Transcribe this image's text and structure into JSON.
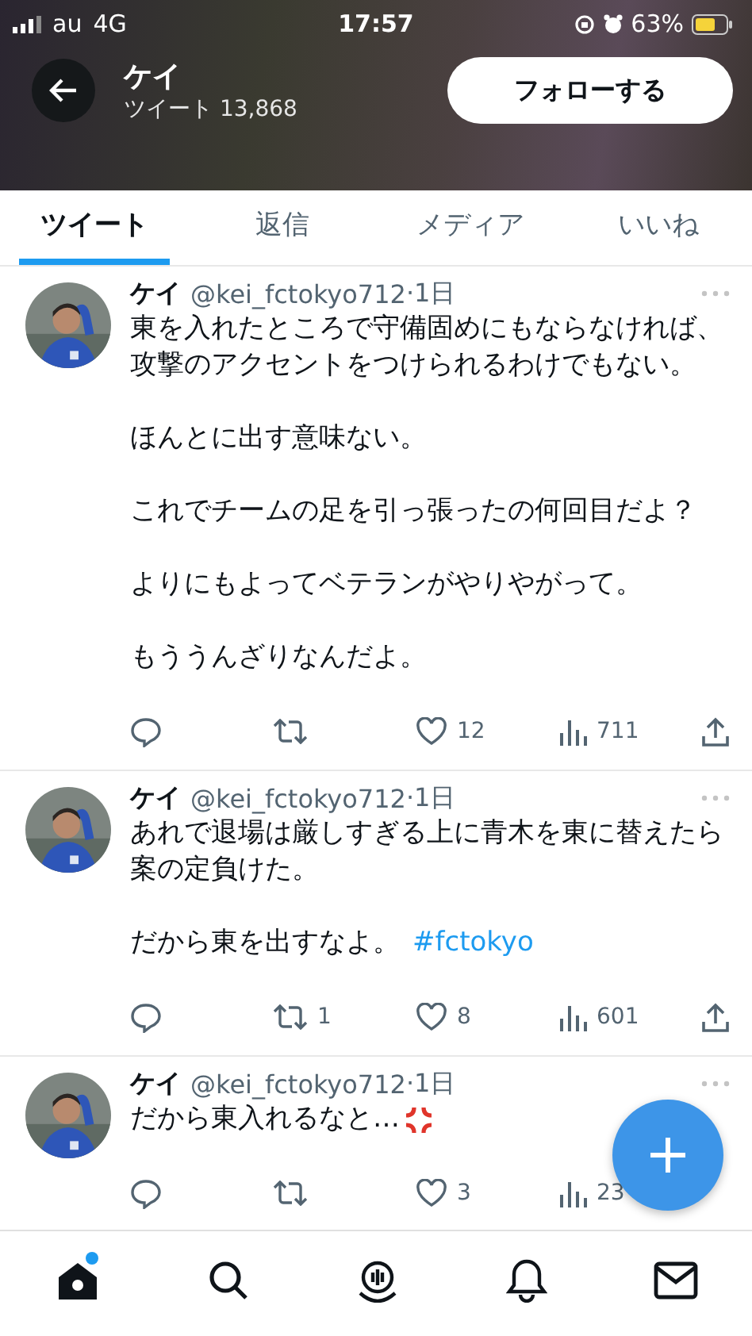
{
  "status_bar": {
    "carrier": "au",
    "network": "4G",
    "time": "17:57",
    "battery": "63%"
  },
  "header": {
    "name": "ケイ",
    "tweet_count": "ツイート 13,868",
    "follow_button": "フォローする"
  },
  "tabs": [
    {
      "label": "ツイート",
      "selected": true
    },
    {
      "label": "返信",
      "selected": false
    },
    {
      "label": "メディア",
      "selected": false
    },
    {
      "label": "いいね",
      "selected": false
    }
  ],
  "tweets": [
    {
      "name": "ケイ",
      "handle": "@kei_fctokyo712",
      "time": "·1日",
      "paragraphs": [
        {
          "text": "東を入れたところで守備固めにもならなければ、攻撃のアクセントをつけられるわけでもない。"
        },
        {
          "text": "ほんとに出す意味ない。"
        },
        {
          "text": "これでチームの足を引っ張ったの何回目だよ？"
        },
        {
          "text": "よりにもよってベテランがやりやがって。"
        },
        {
          "text": "もううんざりなんだよ。"
        }
      ],
      "likes": "12",
      "views": "711",
      "anger_emoji": false
    },
    {
      "name": "ケイ",
      "handle": "@kei_fctokyo712",
      "time": "·1日",
      "paragraphs": [
        {
          "text": "あれで退場は厳しすぎる上に青木を東に替えたら案の定負けた。"
        },
        {
          "text": "だから東を出すなよ。",
          "link": "#fctokyo"
        }
      ],
      "retweets": "1",
      "likes": "8",
      "views": "601",
      "anger_emoji": false
    },
    {
      "name": "ケイ",
      "handle": "@kei_fctokyo712",
      "time": "·1日",
      "paragraphs": [
        {
          "text": "だから東入れるなと…"
        }
      ],
      "likes": "3",
      "views": "23",
      "anger_emoji": true
    }
  ],
  "nav": [
    {
      "kind": "home",
      "selected": true,
      "dot": true
    },
    {
      "kind": "search",
      "selected": false,
      "dot": false
    },
    {
      "kind": "spaces",
      "selected": false,
      "dot": false
    },
    {
      "kind": "notifications",
      "selected": false,
      "dot": false
    },
    {
      "kind": "messages",
      "selected": false,
      "dot": false
    }
  ]
}
